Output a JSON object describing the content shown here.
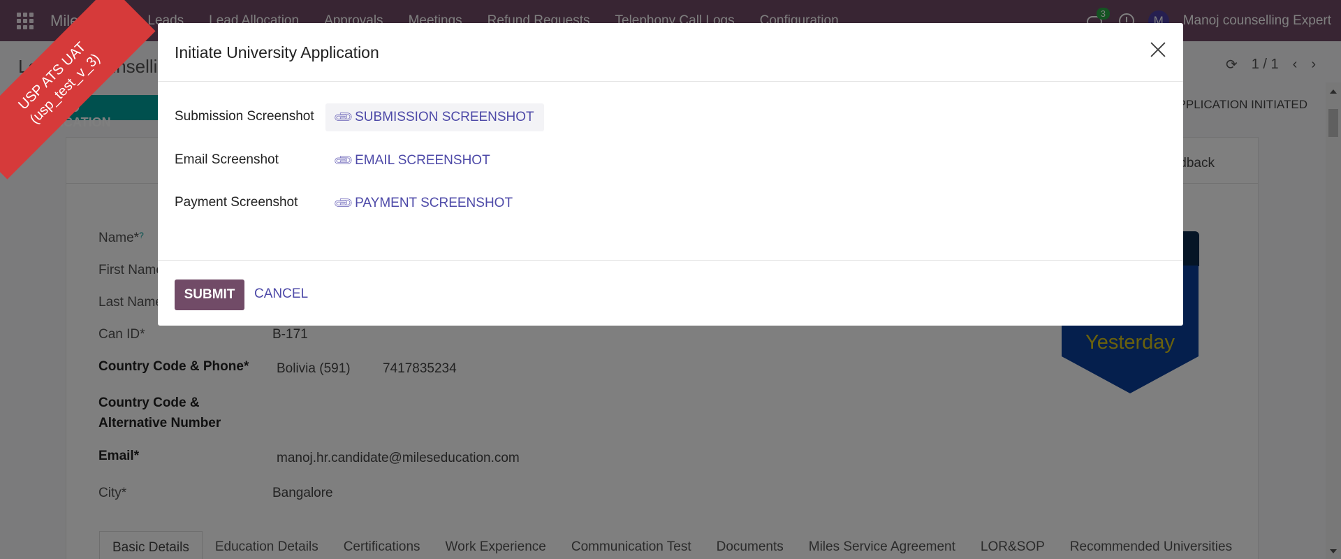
{
  "navbar": {
    "brand": "Miles ATS",
    "menu": [
      "Leads",
      "Lead Allocation",
      "Approvals",
      "Meetings",
      "Refund Requests",
      "Telephony Call Logs",
      "Configuration"
    ],
    "chat_badge": "3",
    "avatar_initial": "M",
    "user_name": "Manoj counselling Expert"
  },
  "control_panel": {
    "breadcrumb": "Leads / Counselling",
    "upload_button": "UPLOAD APPLICATION",
    "pager_text": "1 / 1",
    "stage": "APPLICATION INITIATED"
  },
  "form": {
    "feedback_label": "Feedback",
    "fields": {
      "name_label": "Name*",
      "name_help": "?",
      "first_name_label": "First Name",
      "last_name_label": "Last Name",
      "can_id_label": "Can ID*",
      "can_id_value": "B-171",
      "phone_label": "Country Code & Phone*",
      "phone_country": "Bolivia (591)",
      "phone_number": "7417835234",
      "alt_label_line1": "Country Code &",
      "alt_label_line2": "Alternative Number",
      "email_label": "Email*",
      "email_value": "manoj.hr.candidate@mileseducation.com",
      "city_label": "City*",
      "city_value": "Bangalore"
    },
    "badge_text": "Yesterday",
    "tabs": [
      "Basic Details",
      "Education Details",
      "Certifications",
      "Work Experience",
      "Communication Test",
      "Documents",
      "Miles Service Agreement",
      "LOR&SOP",
      "Recommended Universities"
    ]
  },
  "modal": {
    "title": "Initiate University Application",
    "rows": [
      {
        "label": "Submission Screenshot",
        "button": "SUBMISSION SCREENSHOT"
      },
      {
        "label": "Email Screenshot",
        "button": "EMAIL SCREENSHOT"
      },
      {
        "label": "Payment Screenshot",
        "button": "PAYMENT SCREENSHOT"
      }
    ],
    "submit": "SUBMIT",
    "cancel": "CANCEL"
  },
  "corner_ribbon": {
    "line1": "USP ATS UAT",
    "line2": "(usp_test_v_3)"
  },
  "colors": {
    "navbar": "#714B67",
    "primary_button": "#714B67",
    "link": "#4e4aa8",
    "ribbon": "#d63a3a",
    "badge_shield": "#0a3f9a"
  }
}
